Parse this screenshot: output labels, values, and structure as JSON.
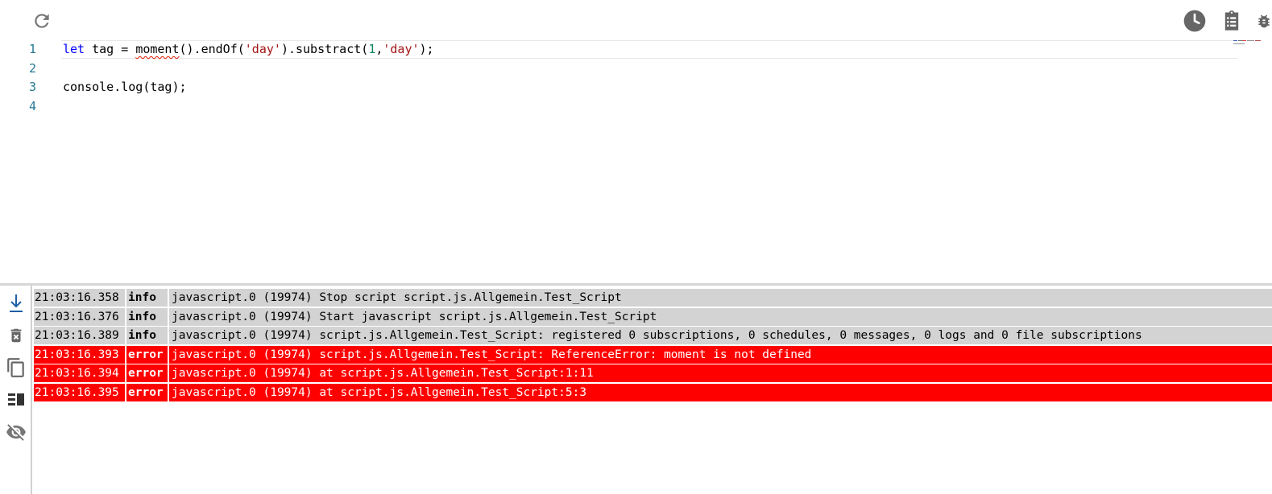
{
  "toolbar": {
    "left_icons": [
      "refresh-icon"
    ],
    "right_icons": [
      "clock-icon",
      "clipboard-list-icon",
      "bug-icon"
    ]
  },
  "editor": {
    "lines": [
      {
        "number": "1",
        "text": "let tag = moment().endOf('day').substract(1,'day');",
        "error_token": "moment"
      },
      {
        "number": "2",
        "text": ""
      },
      {
        "number": "3",
        "text": "console.log(tag);"
      },
      {
        "number": "4",
        "text": ""
      }
    ]
  },
  "log": {
    "sidebar_icons": [
      "scroll-to-bottom-icon",
      "delete-icon",
      "copy-icon",
      "columns-icon",
      "hide-icon"
    ],
    "entries": [
      {
        "time": "21:03:16.358",
        "severity": "info",
        "message": "javascript.0 (19974) Stop script script.js.Allgemein.Test_Script"
      },
      {
        "time": "21:03:16.376",
        "severity": "info",
        "message": "javascript.0 (19974) Start javascript script.js.Allgemein.Test_Script"
      },
      {
        "time": "21:03:16.389",
        "severity": "info",
        "message": "javascript.0 (19974) script.js.Allgemein.Test_Script: registered 0 subscriptions, 0 schedules, 0 messages, 0 logs and 0 file subscriptions"
      },
      {
        "time": "21:03:16.393",
        "severity": "error",
        "message": "javascript.0 (19974) script.js.Allgemein.Test_Script: ReferenceError: moment is not defined"
      },
      {
        "time": "21:03:16.394",
        "severity": "error",
        "message": "javascript.0 (19974) at script.js.Allgemein.Test_Script:1:11"
      },
      {
        "time": "21:03:16.395",
        "severity": "error",
        "message": "javascript.0 (19974) at script.js.Allgemein.Test_Script:5:3"
      }
    ]
  },
  "colors": {
    "error_row": "#ff0000",
    "info_row": "#d3d3d3",
    "keyword": "#0000ff",
    "string": "#a31515",
    "number": "#098658",
    "line_number": "#237893"
  }
}
